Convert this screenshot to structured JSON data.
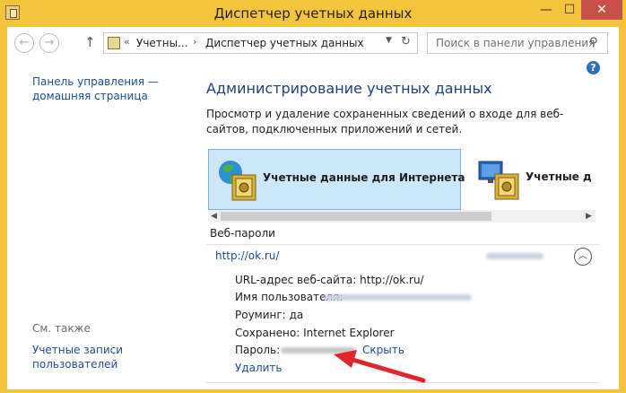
{
  "window": {
    "title": "Диспетчер учетных данных",
    "min_glyph": "—",
    "max_glyph": "☐",
    "close_glyph": "✕"
  },
  "nav": {
    "back_glyph": "←",
    "forward_glyph": "→",
    "up_glyph": "↑"
  },
  "address": {
    "prefix": "«",
    "crumb1": "Учетны...",
    "sep": "›",
    "crumb2": "Диспетчер учетных данных",
    "dropdown_glyph": "▼",
    "refresh_glyph": "↻"
  },
  "search": {
    "placeholder": "Поиск в панели управления",
    "icon_glyph": "⚲"
  },
  "help_glyph": "?",
  "left_panel": {
    "home_link": "Панель управления — домашняя страница",
    "see_also": "См. также",
    "user_accounts_link": "Учетные записи пользователей"
  },
  "main": {
    "title": "Администрирование учетных данных",
    "description": "Просмотр и удаление сохраненных сведений о входе для веб-сайтов, подключенных приложений и сетей.",
    "cards": [
      {
        "label": "Учетные данные для Интернета",
        "icon": "globe-vault-icon",
        "selected": true
      },
      {
        "label": "Учетные д",
        "icon": "monitor-vault-icon",
        "selected": false
      }
    ],
    "scroll_left": "◀",
    "scroll_right": "▶",
    "section_title": "Веб-пароли",
    "entry": {
      "url": "http://ok.ru/",
      "collapse_glyph": "︿",
      "url_label": "URL-адрес веб-сайта:",
      "url_value": "http://ok.ru/",
      "user_label": "Имя пользователя:",
      "roaming_label": "Роуминг:",
      "roaming_value": "да",
      "saved_label": "Сохранено:",
      "saved_value": "Internet Explorer",
      "password_label": "Пароль:",
      "show_link": "Скрыть",
      "delete_link": "Удалить"
    }
  },
  "colors": {
    "titlebar": "#f4c43c",
    "link": "#1c4f8c",
    "heading": "#1e3f80",
    "selected_card": "#cbe7f9",
    "arrow": "#e0262a"
  }
}
